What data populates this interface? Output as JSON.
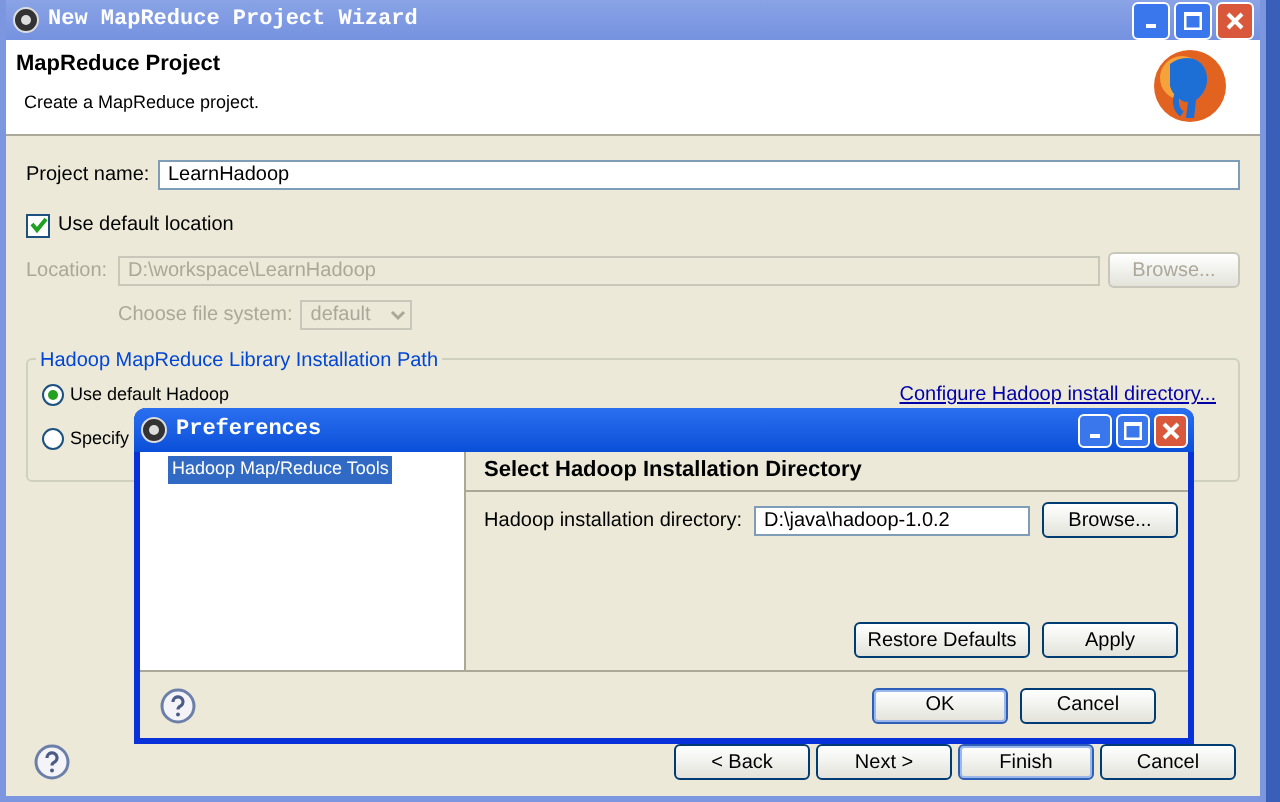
{
  "wizard": {
    "title": "New MapReduce Project Wizard",
    "header_title": "MapReduce Project",
    "header_description": "Create a MapReduce project.",
    "project_name": {
      "label": "Project name:",
      "value": "LearnHadoop"
    },
    "use_default_location": {
      "label": "Use default location",
      "checked": true
    },
    "location": {
      "label": "Location:",
      "value": "D:\\workspace\\LearnHadoop",
      "disabled": true,
      "browse": "Browse..."
    },
    "file_system": {
      "label": "Choose file system:",
      "value": "default",
      "disabled": true
    },
    "group": {
      "title": "Hadoop MapReduce Library Installation Path",
      "options": [
        {
          "label": "Use default Hadoop",
          "selected": true
        },
        {
          "label": "Specify",
          "selected": false
        }
      ],
      "link": "Configure Hadoop install directory..."
    },
    "buttons": [
      "< Back",
      "Next >",
      "Finish",
      "Cancel"
    ]
  },
  "preferences": {
    "title": "Preferences",
    "tree": [
      {
        "label": "Hadoop Map/Reduce Tools",
        "selected": true
      }
    ],
    "page_title": "Select Hadoop Installation Directory",
    "field": {
      "label": "Hadoop installation directory:",
      "value": "D:\\java\\hadoop-1.0.2",
      "browse": "Browse..."
    },
    "page_buttons": [
      "Restore Defaults",
      "Apply"
    ],
    "buttons": [
      "OK",
      "Cancel"
    ]
  }
}
